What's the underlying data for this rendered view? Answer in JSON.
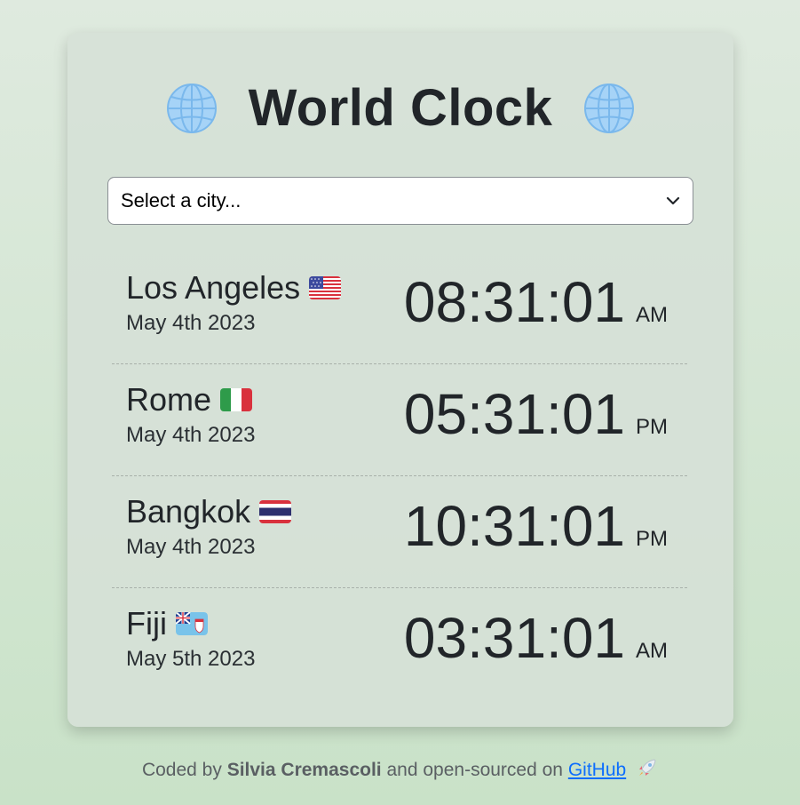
{
  "header": {
    "title": "World Clock",
    "left_icon": "globe-icon",
    "right_icon": "globe-icon"
  },
  "city_select": {
    "selected_label": "Select a city..."
  },
  "cities": [
    {
      "name": "Los Angeles",
      "flag": "us-flag-icon",
      "date": "May 4th 2023",
      "time": "08:31:01",
      "period": "AM"
    },
    {
      "name": "Rome",
      "flag": "italy-flag-icon",
      "date": "May 4th 2023",
      "time": "05:31:01",
      "period": "PM"
    },
    {
      "name": "Bangkok",
      "flag": "thailand-flag-icon",
      "date": "May 4th 2023",
      "time": "10:31:01",
      "period": "PM"
    },
    {
      "name": "Fiji",
      "flag": "fiji-flag-icon",
      "date": "May 5th 2023",
      "time": "03:31:01",
      "period": "AM"
    }
  ],
  "footer": {
    "prefix": "Coded by",
    "author": "Silvia Cremascoli",
    "middle": "and open-sourced on",
    "link_label": "GitHub",
    "icon": "rocket-icon"
  },
  "colors": {
    "background": "#d6e8d5",
    "card": "#d6e1d7",
    "text": "#212529",
    "link": "#0d6efd"
  }
}
